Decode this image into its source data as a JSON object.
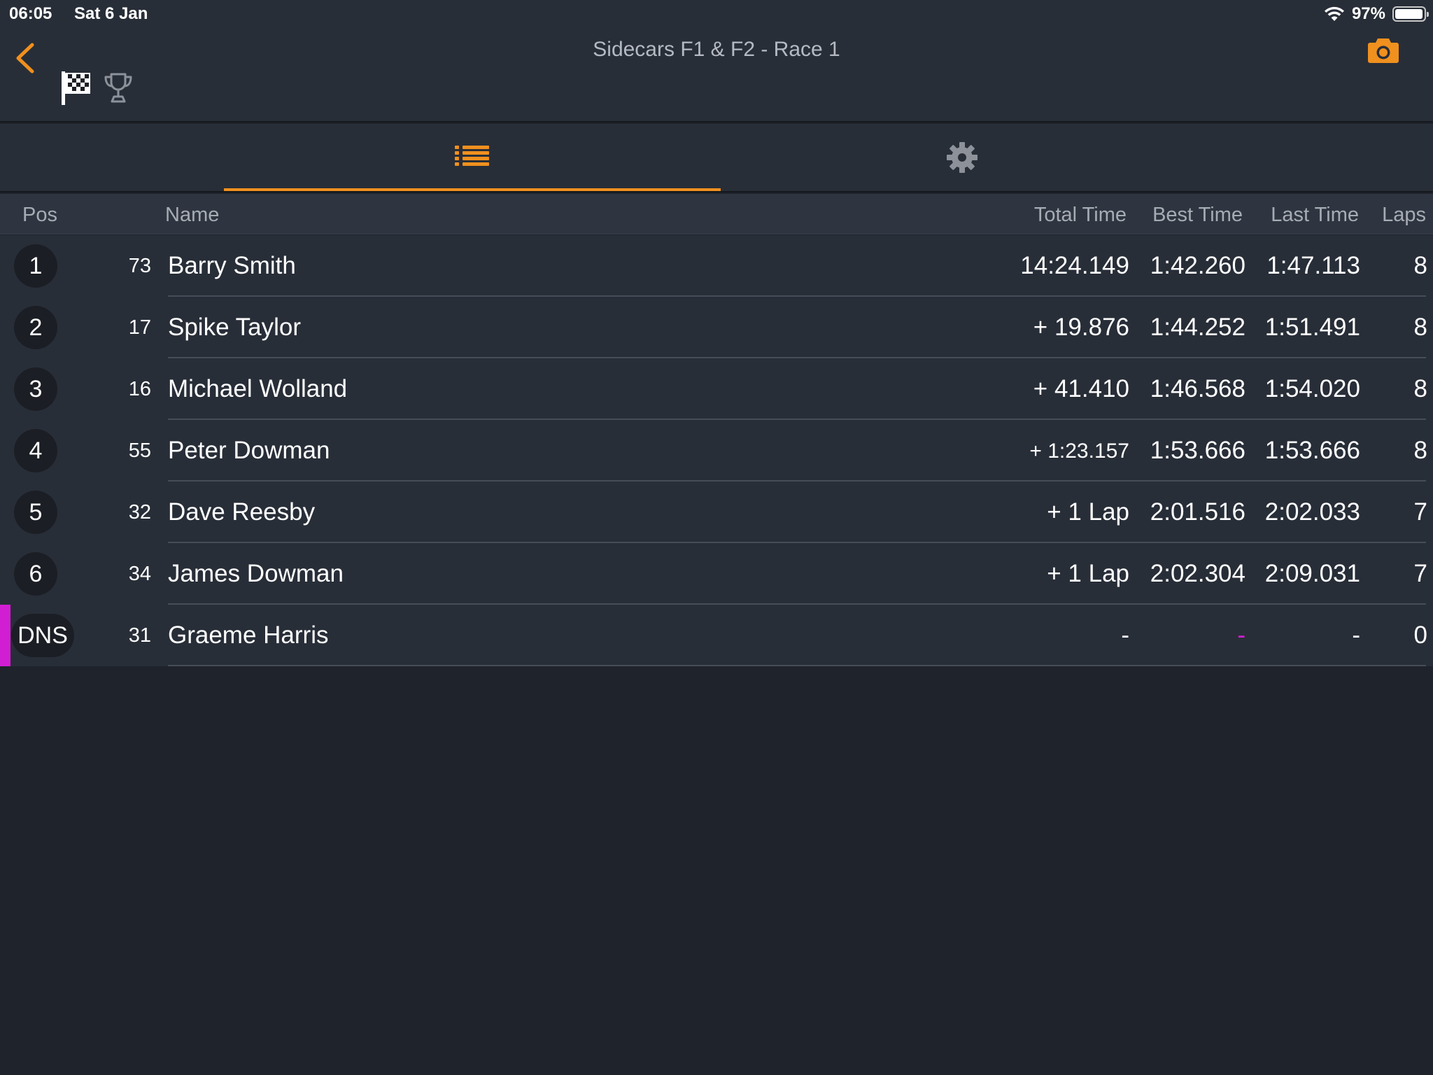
{
  "status_bar": {
    "time": "06:05",
    "date": "Sat 6 Jan",
    "battery": "97%",
    "battery_level": 0.97
  },
  "header": {
    "title": "Sidecars F1 & F2 - Race 1",
    "icons": [
      "back-chevron-icon",
      "checkered-flag-icon",
      "trophy-icon",
      "camera-icon"
    ]
  },
  "tabs": [
    {
      "icon": "list-icon",
      "selected": true
    },
    {
      "icon": "gear-icon",
      "selected": false
    }
  ],
  "columns": {
    "pos": "Pos",
    "name": "Name",
    "total": "Total Time",
    "best": "Best Time",
    "last": "Last Time",
    "laps": "Laps"
  },
  "results": [
    {
      "pos": "1",
      "number": "73",
      "name": "Barry Smith",
      "total": "14:24.149",
      "best": "1:42.260",
      "last": "1:47.113",
      "laps": "8"
    },
    {
      "pos": "2",
      "number": "17",
      "name": "Spike Taylor",
      "total": "+ 19.876",
      "best": "1:44.252",
      "last": "1:51.491",
      "laps": "8"
    },
    {
      "pos": "3",
      "number": "16",
      "name": "Michael Wolland",
      "total": "+ 41.410",
      "best": "1:46.568",
      "last": "1:54.020",
      "laps": "8"
    },
    {
      "pos": "4",
      "number": "55",
      "name": "Peter Dowman",
      "total": "+ 1:23.157",
      "best": "1:53.666",
      "last": "1:53.666",
      "laps": "8"
    },
    {
      "pos": "5",
      "number": "32",
      "name": "Dave Reesby",
      "total": "+ 1 Lap",
      "best": "2:01.516",
      "last": "2:02.033",
      "laps": "7"
    },
    {
      "pos": "6",
      "number": "34",
      "name": "James Dowman",
      "total": "+ 1 Lap",
      "best": "2:02.304",
      "last": "2:09.031",
      "laps": "7"
    },
    {
      "pos": "DNS",
      "number": "31",
      "name": "Graeme Harris",
      "total": "-",
      "best": "-",
      "last": "-",
      "laps": "0"
    }
  ],
  "colors": {
    "accent": "#f0901e",
    "dns_marker": "#d21ed2",
    "background": "#1f232b",
    "row_background": "#282e38"
  }
}
